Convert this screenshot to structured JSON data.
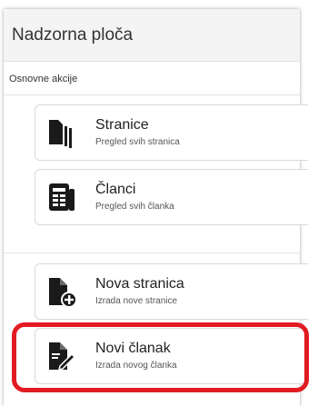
{
  "dashboard": {
    "title": "Nadzorna ploča",
    "section_title": "Osnovne akcije",
    "cards": [
      {
        "icon": "pages-icon",
        "title": "Stranice",
        "subtitle": "Pregled svih stranica"
      },
      {
        "icon": "articles-icon",
        "title": "Članci",
        "subtitle": "Pregled svih članka"
      },
      {
        "icon": "new-page-icon",
        "title": "Nova stranica",
        "subtitle": "Izrada nove stranice"
      },
      {
        "icon": "new-article-icon",
        "title": "Novi članak",
        "subtitle": "Izrada novog članka"
      }
    ]
  },
  "colors": {
    "highlight": "#e21b23",
    "icon": "#1a1a1a"
  }
}
